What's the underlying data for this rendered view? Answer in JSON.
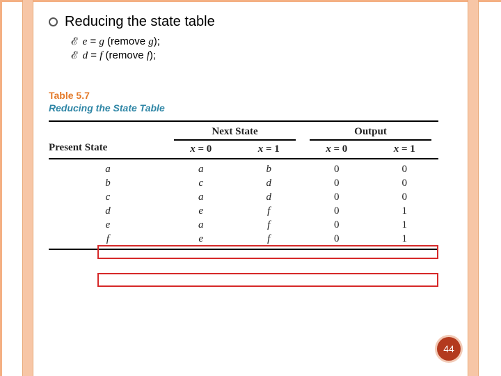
{
  "slide": {
    "title": "Reducing the state table",
    "bullets": [
      {
        "v1": "e",
        "v2": "g",
        "rem": "g"
      },
      {
        "v1": "d",
        "v2": "f",
        "rem": "f"
      }
    ]
  },
  "table": {
    "label": "Table 5.7",
    "caption": "Reducing the State Table",
    "headers": {
      "present": "Present State",
      "next": "Next State",
      "output": "Output",
      "x0": "x = 0",
      "x1": "x = 1"
    },
    "rows": [
      {
        "state": "a",
        "ns0": "a",
        "ns1": "b",
        "o0": "0",
        "o1": "0"
      },
      {
        "state": "b",
        "ns0": "c",
        "ns1": "d",
        "o0": "0",
        "o1": "0"
      },
      {
        "state": "c",
        "ns0": "a",
        "ns1": "d",
        "o0": "0",
        "o1": "0"
      },
      {
        "state": "d",
        "ns0": "e",
        "ns1": "f",
        "o0": "0",
        "o1": "1"
      },
      {
        "state": "e",
        "ns0": "a",
        "ns1": "f",
        "o0": "0",
        "o1": "1"
      },
      {
        "state": "f",
        "ns0": "e",
        "ns1": "f",
        "o0": "0",
        "o1": "1"
      }
    ],
    "highlight": [
      3,
      5
    ]
  },
  "page_number": "44",
  "chart_data": {
    "type": "table",
    "title": "Table 5.7 — Reducing the State Table",
    "columns": [
      "Present State",
      "Next State (x=0)",
      "Next State (x=1)",
      "Output (x=0)",
      "Output (x=1)"
    ],
    "rows": [
      [
        "a",
        "a",
        "b",
        0,
        0
      ],
      [
        "b",
        "c",
        "d",
        0,
        0
      ],
      [
        "c",
        "a",
        "d",
        0,
        0
      ],
      [
        "d",
        "e",
        "f",
        0,
        1
      ],
      [
        "e",
        "a",
        "f",
        0,
        1
      ],
      [
        "f",
        "e",
        "f",
        0,
        1
      ]
    ],
    "highlighted_rows": [
      "d",
      "f"
    ],
    "reductions": [
      "e = g (remove g)",
      "d = f (remove f)"
    ]
  }
}
